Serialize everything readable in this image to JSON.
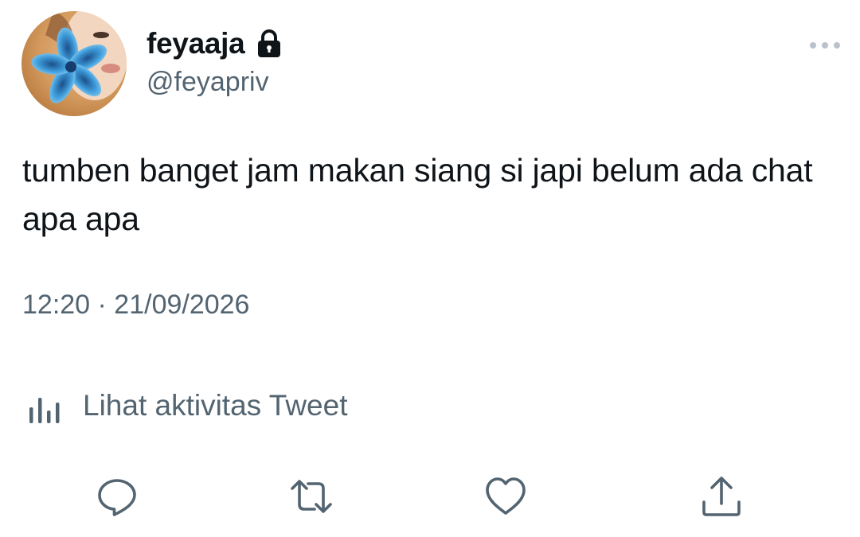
{
  "tweet": {
    "author": {
      "display_name": "feyaaja",
      "handle": "@feyapriv",
      "protected_icon": "lock-icon",
      "avatar": "profile-avatar"
    },
    "menu_icon": "more-icon",
    "text": "tumben banget jam makan siang si japi belum ada chat apa apa",
    "timestamp": "12:20 · 21/09/2026",
    "activity": {
      "icon": "analytics-icon",
      "label": "Lihat aktivitas Tweet"
    },
    "actions": [
      {
        "name": "reply",
        "icon": "reply-icon"
      },
      {
        "name": "retweet",
        "icon": "retweet-icon"
      },
      {
        "name": "like",
        "icon": "heart-icon"
      },
      {
        "name": "share",
        "icon": "share-icon"
      }
    ]
  },
  "colors": {
    "text_primary": "#0f1419",
    "text_secondary": "#536471",
    "background": "#ffffff"
  }
}
